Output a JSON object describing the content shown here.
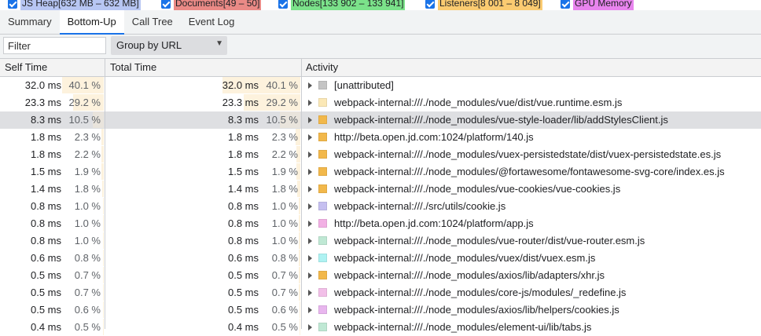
{
  "counters": [
    {
      "label": "JS Heap[632 MB – 632 MB]",
      "color": "#b7c6f3"
    },
    {
      "label": "Documents[49 – 50]",
      "color": "#ea8a86"
    },
    {
      "label": "Nodes[133 902 – 133 941]",
      "color": "#7be28a"
    },
    {
      "label": "Listeners[8 001 – 8 049]",
      "color": "#fbcb71"
    },
    {
      "label": "GPU Memory",
      "color": "#e884ee"
    }
  ],
  "tabs": [
    {
      "label": "Summary",
      "active": false
    },
    {
      "label": "Bottom-Up",
      "active": true
    },
    {
      "label": "Call Tree",
      "active": false
    },
    {
      "label": "Event Log",
      "active": false
    }
  ],
  "toolbar": {
    "filter_placeholder": "Filter",
    "group_by": "Group by URL",
    "dropdown_icon": "triangle-down-icon"
  },
  "columns": {
    "self_time": "Self Time",
    "total_time": "Total Time",
    "activity": "Activity"
  },
  "rows": [
    {
      "self_ms": "32.0 ms",
      "self_pct": "40.1 %",
      "total_ms": "32.0 ms",
      "total_pct": "40.1 %",
      "fraction": 0.401,
      "activity": "[unattributed]",
      "swatch": "#c4c4c4",
      "selected": false
    },
    {
      "self_ms": "23.3 ms",
      "self_pct": "29.2 %",
      "total_ms": "23.3 ms",
      "total_pct": "29.2 %",
      "fraction": 0.292,
      "activity": "webpack-internal:///./node_modules/vue/dist/vue.runtime.esm.js",
      "swatch": "#fbe8b6",
      "selected": false
    },
    {
      "self_ms": "8.3 ms",
      "self_pct": "10.5 %",
      "total_ms": "8.3 ms",
      "total_pct": "10.5 %",
      "fraction": 0.105,
      "activity": "webpack-internal:///./node_modules/vue-style-loader/lib/addStylesClient.js",
      "swatch": "#f2b84b",
      "selected": true
    },
    {
      "self_ms": "1.8 ms",
      "self_pct": "2.3 %",
      "total_ms": "1.8 ms",
      "total_pct": "2.3 %",
      "fraction": 0.023,
      "activity": "http://beta.open.jd.com:1024/platform/140.js",
      "swatch": "#f2b84b",
      "selected": false
    },
    {
      "self_ms": "1.8 ms",
      "self_pct": "2.2 %",
      "total_ms": "1.8 ms",
      "total_pct": "2.2 %",
      "fraction": 0.022,
      "activity": "webpack-internal:///./node_modules/vuex-persistedstate/dist/vuex-persistedstate.es.js",
      "swatch": "#f2b84b",
      "selected": false
    },
    {
      "self_ms": "1.5 ms",
      "self_pct": "1.9 %",
      "total_ms": "1.5 ms",
      "total_pct": "1.9 %",
      "fraction": 0.019,
      "activity": "webpack-internal:///./node_modules/@fortawesome/fontawesome-svg-core/index.es.js",
      "swatch": "#f2b84b",
      "selected": false
    },
    {
      "self_ms": "1.4 ms",
      "self_pct": "1.8 %",
      "total_ms": "1.4 ms",
      "total_pct": "1.8 %",
      "fraction": 0.018,
      "activity": "webpack-internal:///./node_modules/vue-cookies/vue-cookies.js",
      "swatch": "#f2b84b",
      "selected": false
    },
    {
      "self_ms": "0.8 ms",
      "self_pct": "1.0 %",
      "total_ms": "0.8 ms",
      "total_pct": "1.0 %",
      "fraction": 0.01,
      "activity": "webpack-internal:///./src/utils/cookie.js",
      "swatch": "#c5bff0",
      "selected": false
    },
    {
      "self_ms": "0.8 ms",
      "self_pct": "1.0 %",
      "total_ms": "0.8 ms",
      "total_pct": "1.0 %",
      "fraction": 0.01,
      "activity": "http://beta.open.jd.com:1024/platform/app.js",
      "swatch": "#f2b0e4",
      "selected": false
    },
    {
      "self_ms": "0.8 ms",
      "self_pct": "1.0 %",
      "total_ms": "0.8 ms",
      "total_pct": "1.0 %",
      "fraction": 0.01,
      "activity": "webpack-internal:///./node_modules/vue-router/dist/vue-router.esm.js",
      "swatch": "#bfe8d4",
      "selected": false
    },
    {
      "self_ms": "0.6 ms",
      "self_pct": "0.8 %",
      "total_ms": "0.6 ms",
      "total_pct": "0.8 %",
      "fraction": 0.008,
      "activity": "webpack-internal:///./node_modules/vuex/dist/vuex.esm.js",
      "swatch": "#aef2f2",
      "selected": false
    },
    {
      "self_ms": "0.5 ms",
      "self_pct": "0.7 %",
      "total_ms": "0.5 ms",
      "total_pct": "0.7 %",
      "fraction": 0.007,
      "activity": "webpack-internal:///./node_modules/axios/lib/adapters/xhr.js",
      "swatch": "#f2b84b",
      "selected": false
    },
    {
      "self_ms": "0.5 ms",
      "self_pct": "0.7 %",
      "total_ms": "0.5 ms",
      "total_pct": "0.7 %",
      "fraction": 0.007,
      "activity": "webpack-internal:///./node_modules/core-js/modules/_redefine.js",
      "swatch": "#f2bfe8",
      "selected": false
    },
    {
      "self_ms": "0.5 ms",
      "self_pct": "0.6 %",
      "total_ms": "0.5 ms",
      "total_pct": "0.6 %",
      "fraction": 0.006,
      "activity": "webpack-internal:///./node_modules/axios/lib/helpers/cookies.js",
      "swatch": "#e8b6ee",
      "selected": false
    },
    {
      "self_ms": "0.4 ms",
      "self_pct": "0.5 %",
      "total_ms": "0.4 ms",
      "total_pct": "0.5 %",
      "fraction": 0.005,
      "activity": "webpack-internal:///./node_modules/element-ui/lib/tabs.js",
      "swatch": "#bfe8d4",
      "selected": false
    }
  ]
}
